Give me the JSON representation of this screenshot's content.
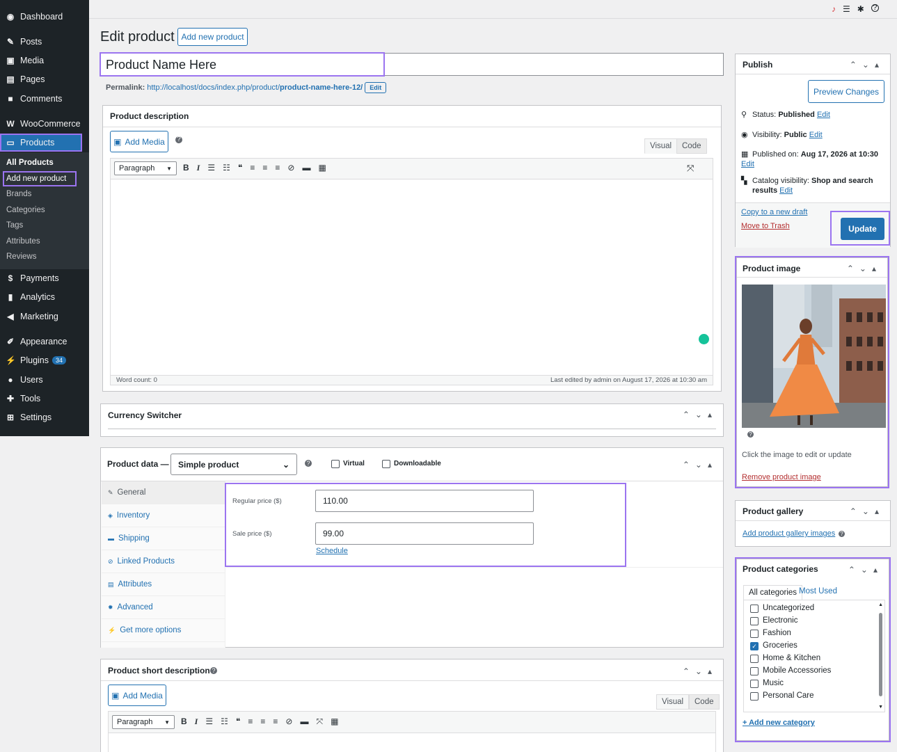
{
  "sidebar": {
    "items": [
      {
        "label": "Dashboard",
        "icon": "dashboard-icon",
        "glyph": "◉"
      },
      {
        "label": "Posts",
        "icon": "pin-icon",
        "glyph": "✎"
      },
      {
        "label": "Media",
        "icon": "media-icon",
        "glyph": "▣"
      },
      {
        "label": "Pages",
        "icon": "pages-icon",
        "glyph": "▤"
      },
      {
        "label": "Comments",
        "icon": "comment-icon",
        "glyph": "■"
      },
      {
        "label": "WooCommerce",
        "icon": "woo-icon",
        "glyph": "W"
      },
      {
        "label": "Products",
        "icon": "products-icon",
        "glyph": "▭"
      },
      {
        "label": "Payments",
        "icon": "payments-icon",
        "glyph": "$"
      },
      {
        "label": "Analytics",
        "icon": "analytics-icon",
        "glyph": "▮"
      },
      {
        "label": "Marketing",
        "icon": "megaphone-icon",
        "glyph": "◀"
      },
      {
        "label": "Appearance",
        "icon": "brush-icon",
        "glyph": "✐"
      },
      {
        "label": "Plugins",
        "icon": "plugin-icon",
        "glyph": "⚡",
        "badge": "34"
      },
      {
        "label": "Users",
        "icon": "user-icon",
        "glyph": "●"
      },
      {
        "label": "Tools",
        "icon": "wrench-icon",
        "glyph": "✚"
      },
      {
        "label": "Settings",
        "icon": "settings-icon",
        "glyph": "⊞"
      }
    ],
    "submenu": [
      "All Products",
      "Add new product",
      "Brands",
      "Categories",
      "Tags",
      "Attributes",
      "Reviews"
    ]
  },
  "topbar": {
    "icons": [
      "bell-icon",
      "list-icon",
      "gear-icon",
      "help-icon"
    ]
  },
  "header": {
    "title": "Edit product",
    "add_new": "Add new product"
  },
  "product": {
    "name": "Product Name Here",
    "permalink_label": "Permalink:",
    "permalink_base": "http://localhost/docs/index.php/product/",
    "permalink_slug": "product-name-here-12/",
    "permalink_edit": "Edit"
  },
  "description": {
    "title": "Product description",
    "add_media": "Add Media",
    "tab_visual": "Visual",
    "tab_code": "Code",
    "format": "Paragraph",
    "word_count": "Word count: 0",
    "last_edited": "Last edited by admin on August 17, 2026 at 10:30 am"
  },
  "currency_switcher": {
    "title": "Currency Switcher"
  },
  "product_data": {
    "title": "Product data —",
    "type": "Simple product",
    "virtual": "Virtual",
    "downloadable": "Downloadable",
    "tabs": [
      "General",
      "Inventory",
      "Shipping",
      "Linked Products",
      "Attributes",
      "Advanced",
      "Get more options"
    ],
    "regular_price_label": "Regular price ($)",
    "regular_price": "110.00",
    "sale_price_label": "Sale price ($)",
    "sale_price": "99.00",
    "schedule": "Schedule"
  },
  "short_description": {
    "title": "Product short description",
    "add_media": "Add Media",
    "tab_visual": "Visual",
    "tab_code": "Code",
    "format": "Paragraph"
  },
  "publish": {
    "title": "Publish",
    "preview": "Preview Changes",
    "status_label": "Status:",
    "status": "Published",
    "edit": "Edit",
    "visibility_label": "Visibility:",
    "visibility": "Public",
    "published_label": "Published on:",
    "published": "Aug 17, 2026 at 10:30",
    "catalog_label": "Catalog visibility:",
    "catalog": "Shop and search results",
    "copy_draft": "Copy to a new draft",
    "trash": "Move to Trash",
    "update": "Update"
  },
  "product_image": {
    "title": "Product image",
    "hint": "Click the image to edit or update",
    "remove": "Remove product image"
  },
  "gallery": {
    "title": "Product gallery",
    "add": "Add product gallery images"
  },
  "categories": {
    "title": "Product categories",
    "tab_all": "All categories",
    "tab_used": "Most Used",
    "items": [
      {
        "label": "Uncategorized",
        "checked": false
      },
      {
        "label": "Electronic",
        "checked": false
      },
      {
        "label": "Fashion",
        "checked": false
      },
      {
        "label": "Groceries",
        "checked": true
      },
      {
        "label": "Home & Kitchen",
        "checked": false
      },
      {
        "label": "Mobile Accessories",
        "checked": false
      },
      {
        "label": "Music",
        "checked": false
      },
      {
        "label": "Personal Care",
        "checked": false
      }
    ],
    "add": "+ Add new category"
  },
  "colors": {
    "accent": "#2271b1",
    "sidebar": "#1d2327",
    "active": "#2271b1",
    "highlight": "#9b74f0",
    "badge": "#2271b1"
  }
}
